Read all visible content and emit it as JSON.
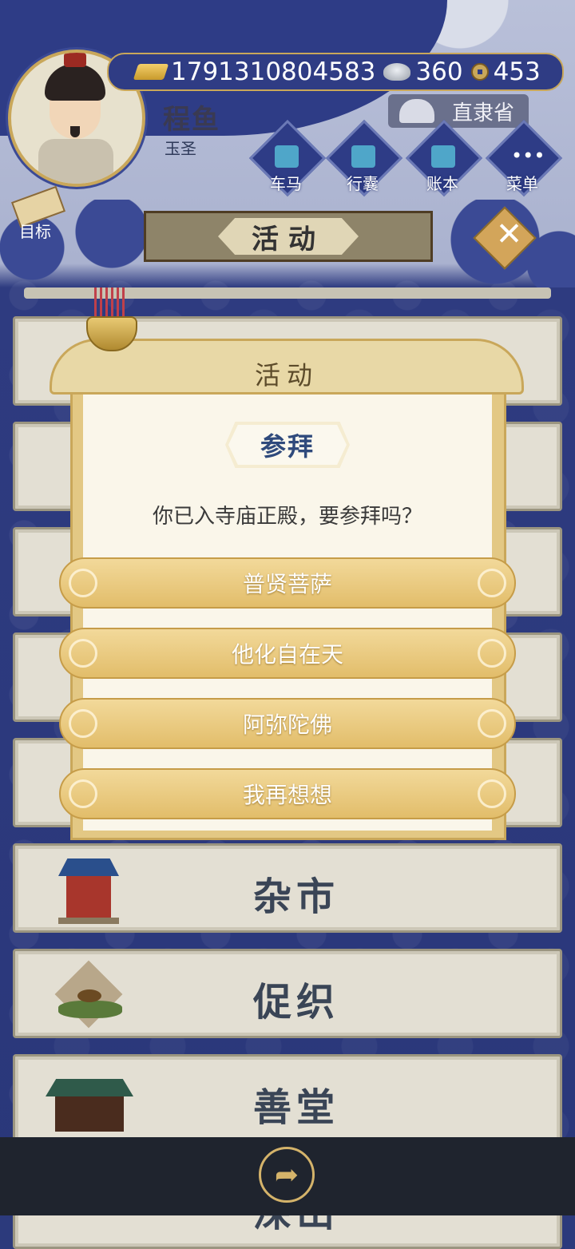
{
  "header": {
    "currency": {
      "gold": "1791310804583",
      "silver": "360",
      "coins": "453"
    },
    "player": {
      "name": "程鱼",
      "title": "玉圣"
    },
    "region": "直隶省",
    "menu": [
      {
        "label": "车马",
        "icon": "carriage-icon"
      },
      {
        "label": "行囊",
        "icon": "bag-icon"
      },
      {
        "label": "账本",
        "icon": "ledger-icon"
      },
      {
        "label": "菜单",
        "icon": "more-icon"
      }
    ],
    "goal_label": "目标",
    "page_title": "活动"
  },
  "activity_list": [
    {
      "label": "杂市",
      "icon": "market-icon"
    },
    {
      "label": "促织",
      "icon": "cricket-icon"
    },
    {
      "label": "善堂",
      "icon": "charity-hall-icon"
    },
    {
      "label": "深山",
      "icon": "mountain-icon"
    }
  ],
  "modal": {
    "header": "活动",
    "subtitle": "参拜",
    "question": "你已入寺庙正殿，要参拜吗？",
    "options": [
      "普贤菩萨",
      "他化自在天",
      "阿弥陀佛",
      "我再想想"
    ]
  },
  "colors": {
    "navy": "#2e3c86",
    "gold": "#c9a75a",
    "parchment": "#faf6ea"
  }
}
